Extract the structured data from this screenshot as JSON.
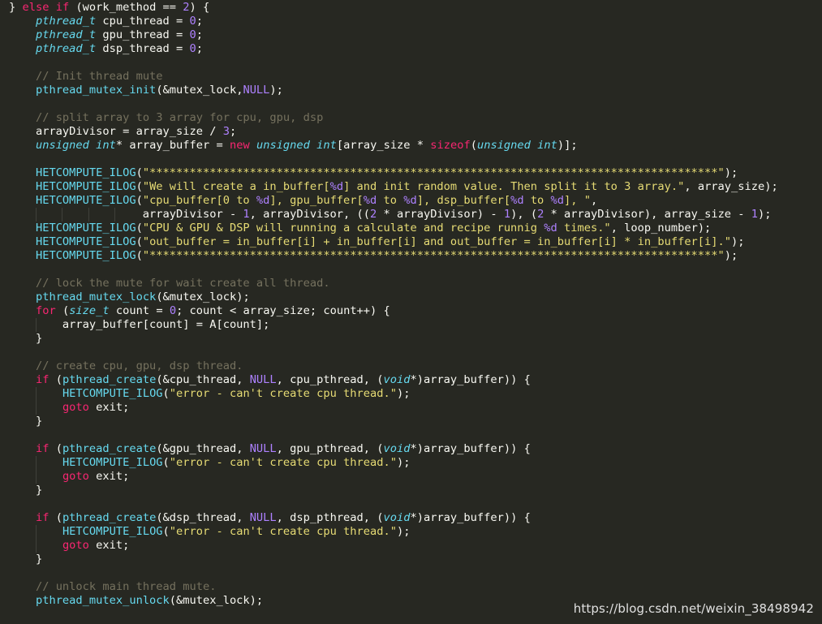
{
  "colors": {
    "background": "#272822",
    "text": "#f8f8f2",
    "keyword": "#f92672",
    "number": "#ae81ff",
    "string": "#e6db74",
    "function": "#66d9ef",
    "type": "#66d9ef",
    "comment": "#75715e"
  },
  "watermark": "https://blog.csdn.net/weixin_38498942",
  "code_lines": [
    [
      [
        "p",
        "} "
      ],
      [
        "kw",
        "else"
      ],
      [
        "p",
        " "
      ],
      [
        "kw",
        "if"
      ],
      [
        "p",
        " (work_method == "
      ],
      [
        "num",
        "2"
      ],
      [
        "p",
        ") {"
      ]
    ],
    [
      [
        "p",
        "    "
      ],
      [
        "typ",
        "pthread_t"
      ],
      [
        "p",
        " cpu_thread = "
      ],
      [
        "num",
        "0"
      ],
      [
        "p",
        ";"
      ]
    ],
    [
      [
        "p",
        "    "
      ],
      [
        "typ",
        "pthread_t"
      ],
      [
        "p",
        " gpu_thread = "
      ],
      [
        "num",
        "0"
      ],
      [
        "p",
        ";"
      ]
    ],
    [
      [
        "p",
        "    "
      ],
      [
        "typ",
        "pthread_t"
      ],
      [
        "p",
        " dsp_thread = "
      ],
      [
        "num",
        "0"
      ],
      [
        "p",
        ";"
      ]
    ],
    [],
    [
      [
        "p",
        "    "
      ],
      [
        "cmt",
        "// Init thread mute"
      ]
    ],
    [
      [
        "p",
        "    "
      ],
      [
        "fn",
        "pthread_mutex_init"
      ],
      [
        "p",
        "(&mutex_lock,"
      ],
      [
        "num",
        "NULL"
      ],
      [
        "p",
        ");"
      ]
    ],
    [],
    [
      [
        "p",
        "    "
      ],
      [
        "cmt",
        "// split array to 3 array for cpu, gpu, dsp"
      ]
    ],
    [
      [
        "p",
        "    arrayDivisor = array_size / "
      ],
      [
        "num",
        "3"
      ],
      [
        "p",
        ";"
      ]
    ],
    [
      [
        "p",
        "    "
      ],
      [
        "typ",
        "unsigned"
      ],
      [
        "p",
        " "
      ],
      [
        "typ",
        "int"
      ],
      [
        "p",
        "* array_buffer = "
      ],
      [
        "kw",
        "new"
      ],
      [
        "p",
        " "
      ],
      [
        "typ",
        "unsigned"
      ],
      [
        "p",
        " "
      ],
      [
        "typ",
        "int"
      ],
      [
        "p",
        "[array_size * "
      ],
      [
        "kw",
        "sizeof"
      ],
      [
        "p",
        "("
      ],
      [
        "typ",
        "unsigned"
      ],
      [
        "p",
        " "
      ],
      [
        "typ",
        "int"
      ],
      [
        "p",
        ")];"
      ]
    ],
    [],
    [
      [
        "p",
        "    "
      ],
      [
        "fn",
        "HETCOMPUTE_ILOG"
      ],
      [
        "p",
        "("
      ],
      [
        "str",
        "\"*************************************************************************************\""
      ],
      [
        "p",
        ");"
      ]
    ],
    [
      [
        "p",
        "    "
      ],
      [
        "fn",
        "HETCOMPUTE_ILOG"
      ],
      [
        "p",
        "("
      ],
      [
        "str",
        "\"We will create a in_buffer["
      ],
      [
        "fmt",
        "%d"
      ],
      [
        "str",
        "] and init random value. Then split it to 3 array.\""
      ],
      [
        "p",
        ", array_size);"
      ]
    ],
    [
      [
        "p",
        "    "
      ],
      [
        "fn",
        "HETCOMPUTE_ILOG"
      ],
      [
        "p",
        "("
      ],
      [
        "str",
        "\"cpu_buffer[0 to "
      ],
      [
        "fmt",
        "%d"
      ],
      [
        "str",
        "], gpu_buffer["
      ],
      [
        "fmt",
        "%d"
      ],
      [
        "str",
        " to "
      ],
      [
        "fmt",
        "%d"
      ],
      [
        "str",
        "], dsp_buffer["
      ],
      [
        "fmt",
        "%d"
      ],
      [
        "str",
        " to "
      ],
      [
        "fmt",
        "%d"
      ],
      [
        "str",
        "], \""
      ],
      [
        "p",
        ","
      ]
    ],
    [
      [
        "p",
        "                    arrayDivisor - "
      ],
      [
        "num",
        "1"
      ],
      [
        "p",
        ", arrayDivisor, (("
      ],
      [
        "num",
        "2"
      ],
      [
        "p",
        " * arrayDivisor) - "
      ],
      [
        "num",
        "1"
      ],
      [
        "p",
        "), ("
      ],
      [
        "num",
        "2"
      ],
      [
        "p",
        " * arrayDivisor), array_size - "
      ],
      [
        "num",
        "1"
      ],
      [
        "p",
        ");"
      ]
    ],
    [
      [
        "p",
        "    "
      ],
      [
        "fn",
        "HETCOMPUTE_ILOG"
      ],
      [
        "p",
        "("
      ],
      [
        "str",
        "\"CPU & GPU & DSP will running a calculate and recipe runnig "
      ],
      [
        "fmt",
        "%d"
      ],
      [
        "str",
        " times.\""
      ],
      [
        "p",
        ", loop_number);"
      ]
    ],
    [
      [
        "p",
        "    "
      ],
      [
        "fn",
        "HETCOMPUTE_ILOG"
      ],
      [
        "p",
        "("
      ],
      [
        "str",
        "\"out_buffer = in_buffer[i] + in_buffer[i] and out_buffer = in_buffer[i] * in_buffer[i].\""
      ],
      [
        "p",
        ");"
      ]
    ],
    [
      [
        "p",
        "    "
      ],
      [
        "fn",
        "HETCOMPUTE_ILOG"
      ],
      [
        "p",
        "("
      ],
      [
        "str",
        "\"*************************************************************************************\""
      ],
      [
        "p",
        ");"
      ]
    ],
    [],
    [
      [
        "p",
        "    "
      ],
      [
        "cmt",
        "// lock the mute for wait create all thread."
      ]
    ],
    [
      [
        "p",
        "    "
      ],
      [
        "fn",
        "pthread_mutex_lock"
      ],
      [
        "p",
        "(&mutex_lock);"
      ]
    ],
    [
      [
        "p",
        "    "
      ],
      [
        "kw",
        "for"
      ],
      [
        "p",
        " ("
      ],
      [
        "typ",
        "size_t"
      ],
      [
        "p",
        " count = "
      ],
      [
        "num",
        "0"
      ],
      [
        "p",
        "; count < array_size; count++) {"
      ]
    ],
    [
      [
        "p",
        "        array_buffer[count] = A[count];"
      ]
    ],
    [
      [
        "p",
        "    }"
      ]
    ],
    [],
    [
      [
        "p",
        "    "
      ],
      [
        "cmt",
        "// create cpu, gpu, dsp thread."
      ]
    ],
    [
      [
        "p",
        "    "
      ],
      [
        "kw",
        "if"
      ],
      [
        "p",
        " ("
      ],
      [
        "fn",
        "pthread_create"
      ],
      [
        "p",
        "(&cpu_thread, "
      ],
      [
        "num",
        "NULL"
      ],
      [
        "p",
        ", cpu_pthread, ("
      ],
      [
        "typ",
        "void"
      ],
      [
        "p",
        "*)array_buffer)) {"
      ]
    ],
    [
      [
        "p",
        "        "
      ],
      [
        "fn",
        "HETCOMPUTE_ILOG"
      ],
      [
        "p",
        "("
      ],
      [
        "str",
        "\"error - can't create cpu thread.\""
      ],
      [
        "p",
        ");"
      ]
    ],
    [
      [
        "p",
        "        "
      ],
      [
        "kw",
        "goto"
      ],
      [
        "p",
        " exit;"
      ]
    ],
    [
      [
        "p",
        "    }"
      ]
    ],
    [],
    [
      [
        "p",
        "    "
      ],
      [
        "kw",
        "if"
      ],
      [
        "p",
        " ("
      ],
      [
        "fn",
        "pthread_create"
      ],
      [
        "p",
        "(&gpu_thread, "
      ],
      [
        "num",
        "NULL"
      ],
      [
        "p",
        ", gpu_pthread, ("
      ],
      [
        "typ",
        "void"
      ],
      [
        "p",
        "*)array_buffer)) {"
      ]
    ],
    [
      [
        "p",
        "        "
      ],
      [
        "fn",
        "HETCOMPUTE_ILOG"
      ],
      [
        "p",
        "("
      ],
      [
        "str",
        "\"error - can't create cpu thread.\""
      ],
      [
        "p",
        ");"
      ]
    ],
    [
      [
        "p",
        "        "
      ],
      [
        "kw",
        "goto"
      ],
      [
        "p",
        " exit;"
      ]
    ],
    [
      [
        "p",
        "    }"
      ]
    ],
    [],
    [
      [
        "p",
        "    "
      ],
      [
        "kw",
        "if"
      ],
      [
        "p",
        " ("
      ],
      [
        "fn",
        "pthread_create"
      ],
      [
        "p",
        "(&dsp_thread, "
      ],
      [
        "num",
        "NULL"
      ],
      [
        "p",
        ", dsp_pthread, ("
      ],
      [
        "typ",
        "void"
      ],
      [
        "p",
        "*)array_buffer)) {"
      ]
    ],
    [
      [
        "p",
        "        "
      ],
      [
        "fn",
        "HETCOMPUTE_ILOG"
      ],
      [
        "p",
        "("
      ],
      [
        "str",
        "\"error - can't create cpu thread.\""
      ],
      [
        "p",
        ");"
      ]
    ],
    [
      [
        "p",
        "        "
      ],
      [
        "kw",
        "goto"
      ],
      [
        "p",
        " exit;"
      ]
    ],
    [
      [
        "p",
        "    }"
      ]
    ],
    [],
    [
      [
        "p",
        "    "
      ],
      [
        "cmt",
        "// unlock main thread mute."
      ]
    ],
    [
      [
        "p",
        "    "
      ],
      [
        "fn",
        "pthread_mutex_unlock"
      ],
      [
        "p",
        "(&mutex_lock);"
      ]
    ]
  ]
}
